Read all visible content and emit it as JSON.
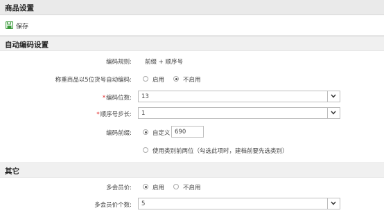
{
  "page": {
    "title": "商品设置"
  },
  "toolbar": {
    "save_label": "保存"
  },
  "auto_code": {
    "section_title": "自动编码设置",
    "rule_label": "编码规则:",
    "rule_value": "前缀 + 顺序号",
    "weighing_label": "称重商品以5位货号自动编码:",
    "weighing_options": [
      "启用",
      "不启用"
    ],
    "weighing_selected": "不启用",
    "digits_label": "编码位数:",
    "digits_value": "13",
    "step_label": "顺序号步长:",
    "step_value": "1",
    "prefix_label": "编码前缀:",
    "prefix_custom_label": "自定义",
    "prefix_custom_value": "690",
    "prefix_category_label": "使用类别前两位（勾选此项时，建档前要先选类别）",
    "prefix_selected": "自定义"
  },
  "other": {
    "section_title": "其它",
    "member_price_label": "多会员价:",
    "member_price_options": [
      "启用",
      "不启用"
    ],
    "member_price_selected": "启用",
    "member_price_count_label": "多会员价个数:",
    "member_price_count_value": "5"
  },
  "required_marker": "*",
  "colors": {
    "required": "#e02020",
    "save_icon": "#3a9a3a"
  }
}
